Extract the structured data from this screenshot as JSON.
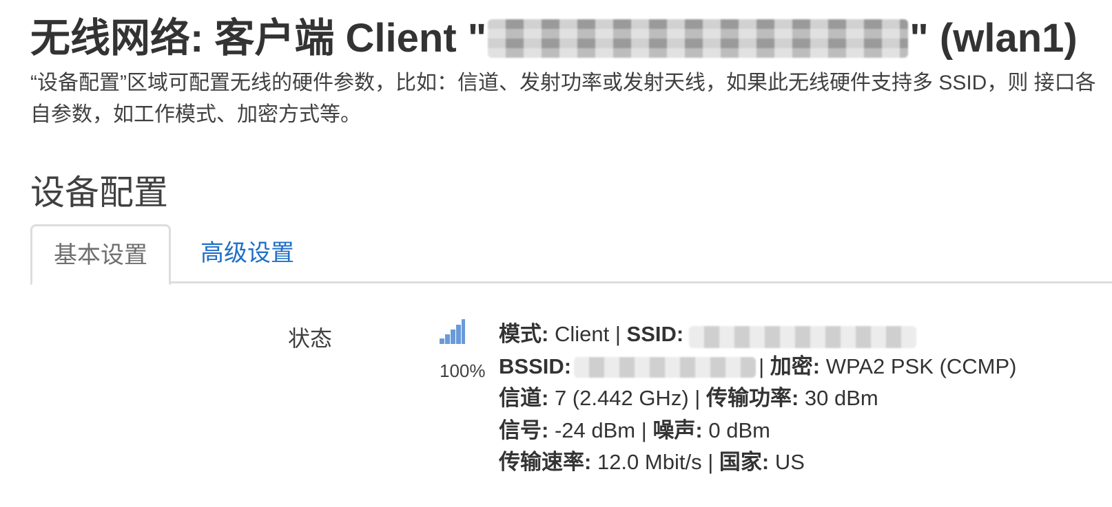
{
  "title": {
    "prefix": "无线网络: 客户端 Client \"",
    "suffix": "\" (wlan1)"
  },
  "description": "“设备配置”区域可配置无线的硬件参数，比如：信道、发射功率或发射天线，如果此无线硬件支持多 SSID，则 接口各自参数，如工作模式、加密方式等。",
  "section_title": "设备配置",
  "tabs": [
    {
      "label": "基本设置",
      "active": true
    },
    {
      "label": "高级设置",
      "active": false
    }
  ],
  "status": {
    "label": "状态",
    "signal_icon": "signal-strength-icon",
    "signal_percent": "100%",
    "signal_level": 1.0,
    "mode_label": "模式:",
    "mode_value": "Client",
    "ssid_label": "SSID:",
    "bssid_label": "BSSID:",
    "encryption_label": "加密:",
    "encryption_value": "WPA2 PSK (CCMP)",
    "channel_label": "信道:",
    "channel_value": "7 (2.442 GHz)",
    "txpower_label": "传输功率:",
    "txpower_value": "30 dBm",
    "signal_label": "信号:",
    "signal_value": "-24 dBm",
    "noise_label": "噪声:",
    "noise_value": "0 dBm",
    "bitrate_label": "传输速率:",
    "bitrate_value": "12.0 Mbit/s",
    "country_label": "国家:",
    "country_value": "US",
    "separator": "|"
  },
  "colors": {
    "text": "#333333",
    "link": "#1f6fc5",
    "tab_border": "#dddddd",
    "signal_bars": "#6a9bd8"
  }
}
